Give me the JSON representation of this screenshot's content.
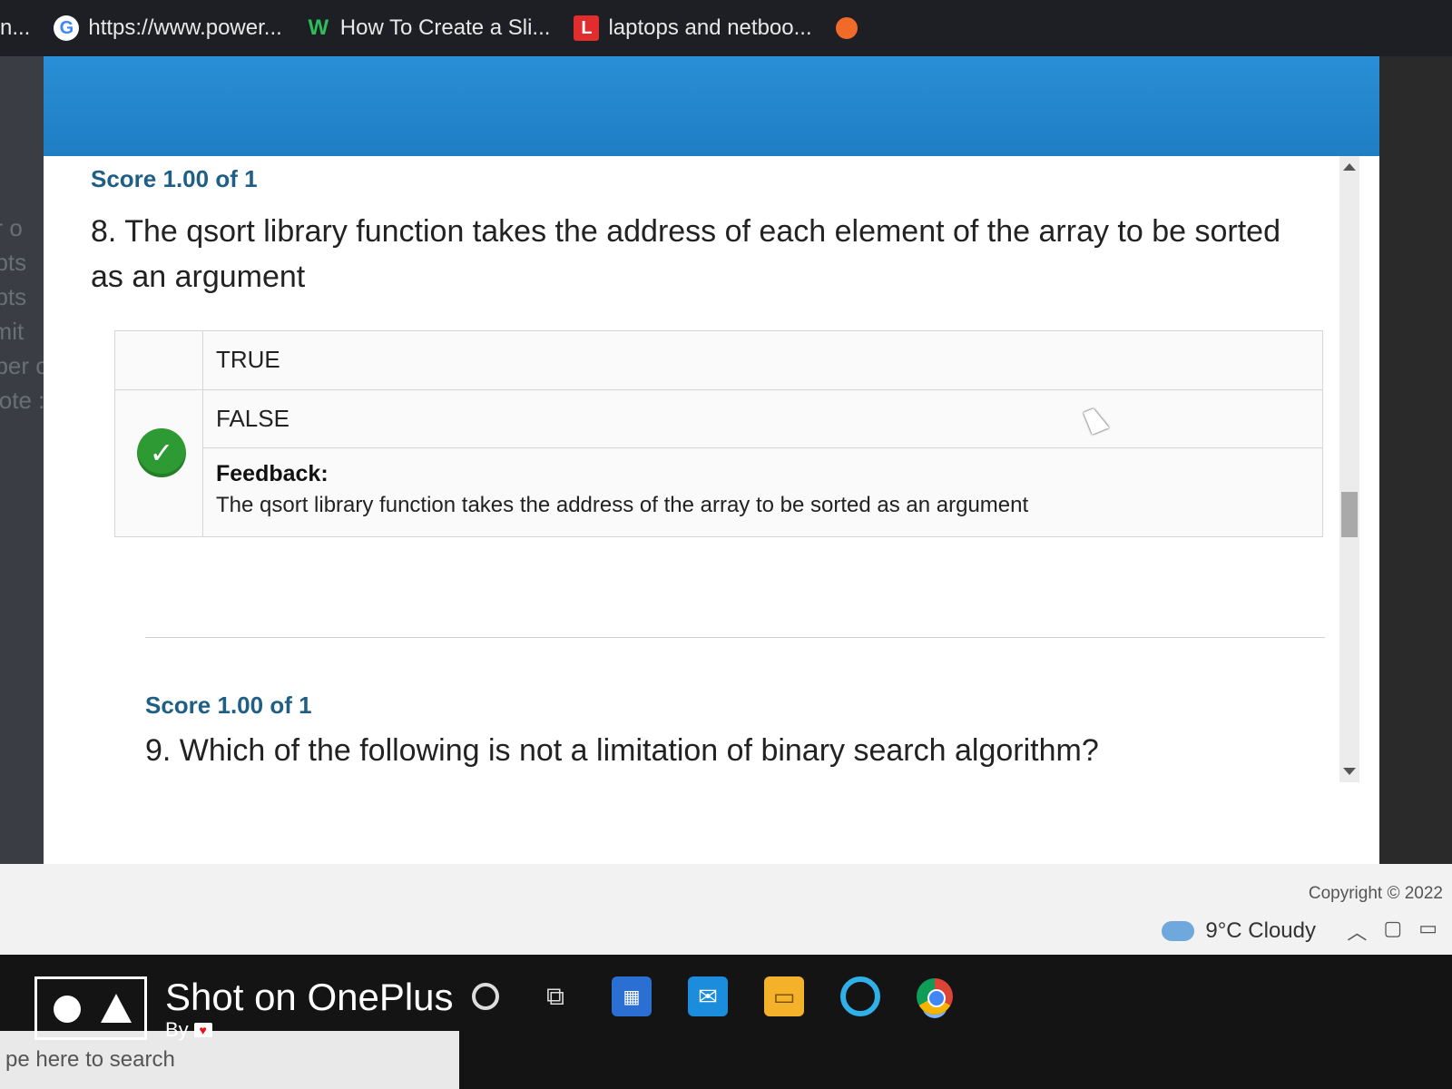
{
  "bookmarks": [
    {
      "label": "n...",
      "icon": "none"
    },
    {
      "label": "https://www.power...",
      "icon": "google-icon"
    },
    {
      "label": "How To Create a Sli...",
      "icon": "w-logo-icon"
    },
    {
      "label": "laptops and netboo...",
      "icon": "l-logo-icon"
    }
  ],
  "page_left_fragments": [
    "er o",
    "npts",
    "npts",
    "limit",
    "nber o",
    "Note :"
  ],
  "q8": {
    "score": "Score 1.00 of 1",
    "question": "8. The qsort library function takes the address of each element of the array to be sorted as an argument",
    "options": [
      "TRUE",
      "FALSE"
    ],
    "selected_correct": "FALSE",
    "feedback_label": "Feedback:",
    "feedback_text": "The qsort library function takes the address of the array to be sorted as an argument"
  },
  "q9": {
    "score": "Score 1.00 of 1",
    "question": "9. Which of the following is not a limitation of binary search algorithm?"
  },
  "footer": {
    "copyright": "Copyright © 2022"
  },
  "taskbar": {
    "search_placeholder": "pe here to search",
    "weather": "9°C Cloudy",
    "icons": [
      "cortana-icon",
      "task-view-icon",
      "store-icon",
      "mail-icon",
      "file-explorer-icon",
      "edge-icon",
      "chrome-icon"
    ]
  },
  "watermark": {
    "title": "Shot on OnePlus",
    "by": "By"
  },
  "colors": {
    "header_blue": "#1f7ec4",
    "score_blue": "#1f5f86",
    "check_green": "#2e9a33"
  }
}
